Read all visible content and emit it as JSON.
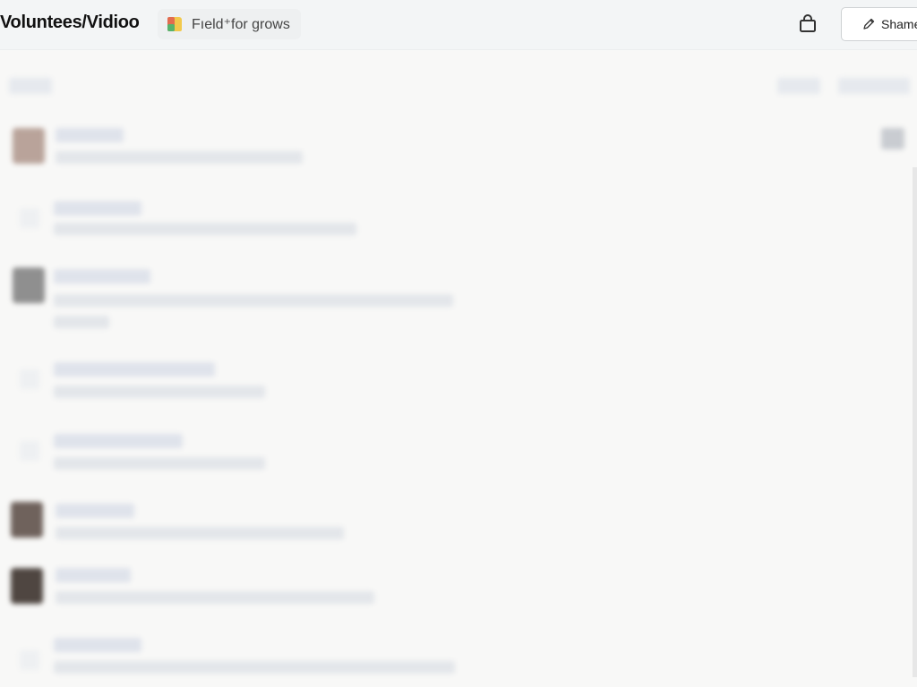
{
  "header": {
    "title": "Voluntees/Vidioo",
    "field_chip_label": "Fıeld⁺for grows",
    "share_label": "Shame"
  },
  "icons": {
    "field_chip": "color-grid-icon",
    "bag": "bag-icon",
    "share": "pencil-icon"
  },
  "colors": {
    "header_bg": "#f3f5f6",
    "page_bg": "#f8f8f7",
    "chip_bg": "#eef0f1",
    "placeholder": "#dfe3eb"
  }
}
